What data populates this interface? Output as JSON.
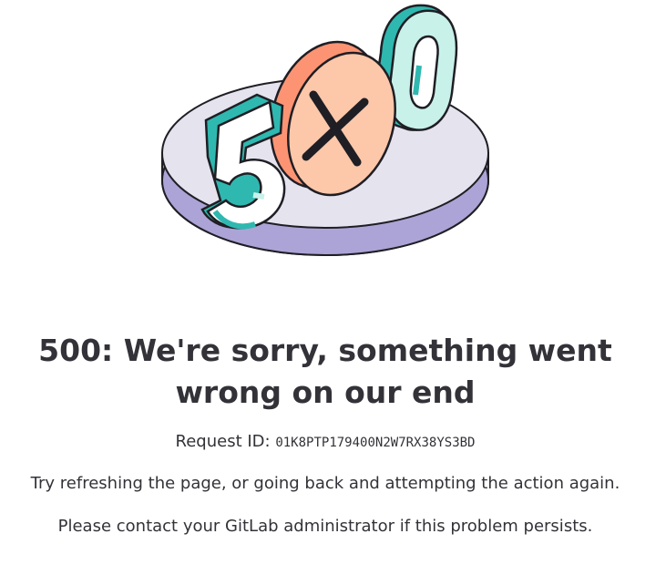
{
  "illustration": {
    "digits": [
      "5",
      "0"
    ],
    "icon": "x-mark-icon",
    "colors": {
      "platform_top": "#e5e3ee",
      "platform_side": "#aca4d6",
      "teal": "#2fb8b0",
      "teal_light": "#c8f1ea",
      "orange": "#fc9473",
      "peach": "#fdc7aa",
      "outline": "#1f1e24"
    }
  },
  "error": {
    "title": "500: We're sorry, something went wrong on our end",
    "request_id_label": "Request ID:",
    "request_id_value": "01K8PTP179400N2W7RX38YS3BD",
    "message_1": "Try refreshing the page, or going back and attempting the action again.",
    "message_2": "Please contact your GitLab administrator if this problem persists."
  }
}
